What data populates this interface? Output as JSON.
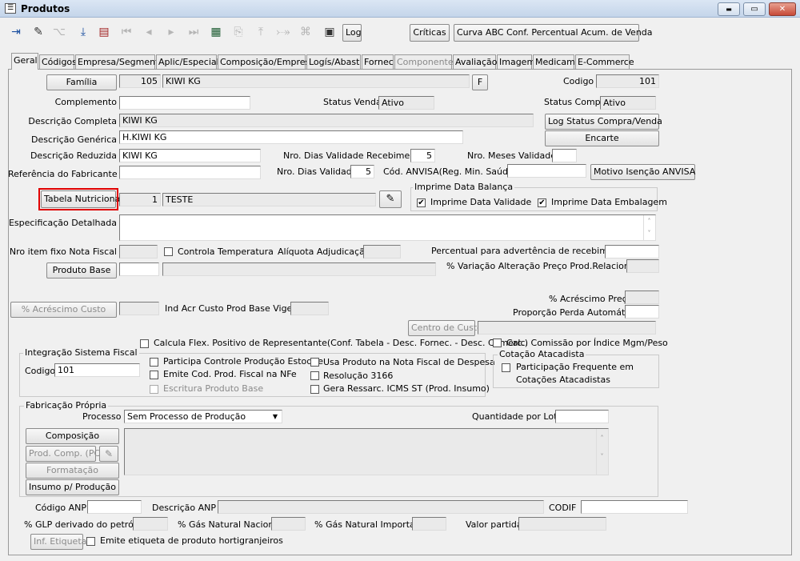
{
  "window": {
    "title": "Produtos",
    "min_label": "▬",
    "max_label": "▭",
    "close_label": "✕"
  },
  "toolbar": {
    "log_label": "Log",
    "criticas_label": "Críticas",
    "curva_label": "Curva ABC Conf. Percentual Acum. de Venda",
    "icons": [
      "exit-icon",
      "eraser-icon",
      "tree-icon",
      "save-icon",
      "print-icon",
      "first-icon",
      "prev-icon",
      "next-icon",
      "last-icon",
      "list-view-icon",
      "copy-icon",
      "import-icon",
      "export-icon",
      "attach-icon",
      "calculator-icon"
    ]
  },
  "tabs": [
    {
      "label": "Geral",
      "active": true
    },
    {
      "label": "Códigos"
    },
    {
      "label": "Empresa/Segmento"
    },
    {
      "label": "Aplic/Especial"
    },
    {
      "label": "Composição/Empresa"
    },
    {
      "label": "Logís/Abast"
    },
    {
      "label": "Fornec"
    },
    {
      "label": "Componentes",
      "disabled": true
    },
    {
      "label": "Avaliação"
    },
    {
      "label": "Imagem"
    },
    {
      "label": "Medicam."
    },
    {
      "label": "E-Commerce"
    }
  ],
  "form": {
    "familia_btn": "Família",
    "familia_code": "105",
    "familia_name": "KIWI KG",
    "f_btn": "F",
    "codigo_label": "Codigo",
    "codigo_value": "101",
    "complemento_label": "Complemento",
    "complemento_value": "",
    "status_venda_label": "Status Venda",
    "status_venda_value": "Ativo",
    "status_compra_label": "Status Compra",
    "status_compra_value": "Ativo",
    "desc_completa_label": "Descrição Completa",
    "desc_completa_value": "KIWI KG",
    "log_status_btn": "Log Status Compra/Venda",
    "desc_generica_label": "Descrição Genérica",
    "desc_generica_value": "H.KIWI KG",
    "encarte_btn": "Encarte",
    "desc_reduzida_label": "Descrição Reduzida",
    "desc_reduzida_value": "KIWI KG",
    "dias_receb_label": "Nro. Dias Validade Recebimento",
    "dias_receb_value": "5",
    "meses_validade_label": "Nro. Meses Validade",
    "meses_validade_value": "",
    "ref_fabricante_label": "Referência do Fabricante",
    "ref_fabricante_value": "",
    "dias_validade_label": "Nro. Dias Validade",
    "dias_validade_value": "5",
    "anvisa_label": "Cód. ANVISA(Reg. Min. Saúde)",
    "anvisa_value": "",
    "motivo_anvisa_btn": "Motivo Isenção ANVISA",
    "tabela_nutri_btn": "Tabela Nutricional",
    "tabela_nutri_code": "1",
    "tabela_nutri_name": "TESTE",
    "imprime_balanca_title": "Imprime Data Balança",
    "imprime_validade_label": "Imprime Data Validade",
    "imprime_validade_checked": "✔",
    "imprime_embalagem_label": "Imprime Data Embalagem",
    "imprime_embalagem_checked": "✔",
    "espec_label": "Especificação Detalhada",
    "espec_value": "",
    "nro_item_label": "Nro item fixo Nota Fiscal",
    "nro_item_value": "",
    "controla_temp_label": "Controla Temperatura",
    "aliquota_label": "Alíquota Adjudicação",
    "aliquota_value": "",
    "percentual_adv_label": "Percentual para advertência de recebimento",
    "percentual_adv_value": "",
    "produto_base_btn": "Produto Base",
    "produto_base_code": "",
    "produto_base_name": "",
    "variacao_label": "% Variação Alteração Preço Prod.Relacionado",
    "variacao_value": "",
    "acrescimo_preco_label": "% Acréscimo Preço",
    "acrescimo_preco_value": "",
    "acrescimo_custo_btn": "% Acréscimo Custo",
    "acrescimo_custo_value": "",
    "ind_acr_label": "Ind Acr Custo Prod Base Vigente",
    "ind_acr_value": "",
    "proporcao_label": "Proporção Perda Automática",
    "proporcao_value": "",
    "centro_custo_btn": "Centro de Custo",
    "centro_custo_value": "",
    "calcula_flex_label": "Calcula Flex. Positivo de Representante(Conf. Tabela - Desc. Fornec. - Desc. Comerc.)",
    "calc_comissao_label": "Calc. Comissão por Índice Mgm/Peso",
    "integracao_title": "Integração Sistema Fiscal",
    "int_codigo_label": "Codigo",
    "int_codigo_value": "101",
    "participa_label": "Participa Controle Produção Estoque",
    "emite_cod_label": "Emite Cod. Prod. Fiscal na NFe",
    "escritura_label": "Escritura Produto Base",
    "usa_produto_label": "Usa Produto na Nota Fiscal de Despesa",
    "resolucao_label": "Resolução 3166",
    "gera_ressarc_label": "Gera Ressarc. ICMS ST (Prod. Insumo)",
    "cotacao_title": "Cotação Atacadista",
    "participacao_label": "Participação Frequente em",
    "participacao_label2": "Cotações Atacadistas",
    "fabricacao_title": "Fabricação Própria",
    "processo_label": "Processo",
    "processo_value": "Sem Processo de Produção",
    "qtd_lote_label": "Quantidade por Lote",
    "qtd_lote_value": "",
    "composicao_btn": "Composição",
    "prod_comp_btn": "Prod. Comp. (PC)",
    "formatacao_btn": "Formatação",
    "insumo_btn": "Insumo p/ Produção",
    "fab_memo_value": "",
    "codigo_anp_label": "Código ANP",
    "codigo_anp_value": "",
    "descricao_anp_label": "Descrição ANP",
    "descricao_anp_value": "",
    "codif_label": "CODIF",
    "codif_value": "",
    "glp_label": "% GLP derivado do petróleo",
    "glp_value": "",
    "gas_nac_label": "% Gás Natural Nacional",
    "gas_nac_value": "",
    "gas_imp_label": "% Gás Natural Importado",
    "gas_imp_value": "",
    "valor_partida_label": "Valor partida",
    "valor_partida_value": "",
    "inf_etiqueta_btn": "Inf. Etiqueta",
    "emite_etiqueta_label": "Emite etiqueta de produto hortigranjeiros"
  },
  "colors": {
    "highlight": "#e00000",
    "titlebar": "#c4d5ea",
    "background": "#f0f0f0"
  }
}
